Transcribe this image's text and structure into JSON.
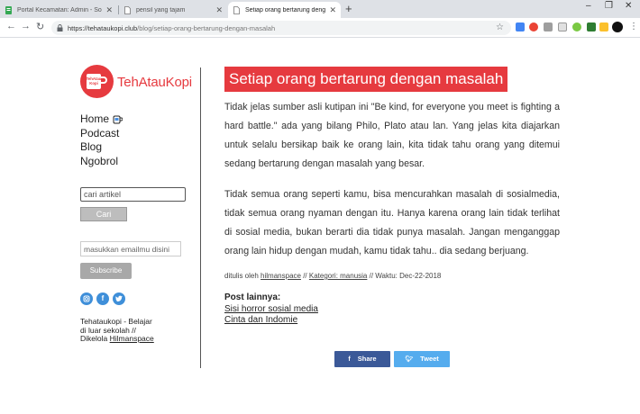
{
  "browser": {
    "tabs": [
      {
        "title": "Portal Kecamatan: Admin - Socra",
        "active": false
      },
      {
        "title": "pensil yang tajam",
        "active": false
      },
      {
        "title": "Setiap orang bertarung dengan m",
        "active": true
      }
    ],
    "url_host": "https://tehataukopi.club",
    "url_path": "/blog/setiap-orang-bertarung-dengan-masalah"
  },
  "sidebar": {
    "logo_text": "TehAtauKopi",
    "logo_badge": "TehAtau Kopi",
    "nav": [
      "Home",
      "Podcast",
      "Blog",
      "Ngobrol"
    ],
    "search_placeholder": "cari artikel",
    "search_button": "Cari",
    "email_placeholder": "masukkan emailmu disini",
    "subscribe_button": "Subscribe",
    "social_icons": [
      "instagram-icon",
      "facebook-icon",
      "twitter-icon"
    ],
    "about_text": "Tehataukopi - Belajar di luar sekolah // Dikelola",
    "about_link": "Hilmanspace"
  },
  "article": {
    "title": "Setiap orang bertarung dengan masalah",
    "paragraphs": [
      "Tidak jelas sumber asli kutipan ini \"Be kind, for everyone you meet is fighting a hard battle.\" ada yang bilang Philo, Plato atau lan. Yang jelas kita diajarkan untuk selalu bersikap baik ke orang lain, kita tidak tahu orang yang ditemui sedang bertarung dengan masalah yang besar.",
      "Tidak semua orang seperti kamu, bisa mencurahkan masalah di sosialmedia, tidak semua orang nyaman dengan itu. Hanya karena orang lain tidak terlihat di sosial media, bukan berarti dia tidak punya masalah. Jangan menganggap orang lain hidup dengan mudah, kamu tidak tahu.. dia sedang berjuang."
    ],
    "meta": {
      "written_by": "ditulis oleh",
      "author": "hilmanspace",
      "sep1": "//",
      "category_label": "Kategori: manusia",
      "sep2": "//",
      "date_text": "Waktu: Dec-22-2018"
    },
    "other_posts_heading": "Post lainnya:",
    "other_posts": [
      "Sisi horror sosial media",
      "Cinta dan Indomie"
    ],
    "share_label": "Share",
    "tweet_label": "Tweet"
  },
  "colors": {
    "brand_red": "#e63a3f",
    "facebook": "#3b5998",
    "twitter": "#55acee"
  }
}
